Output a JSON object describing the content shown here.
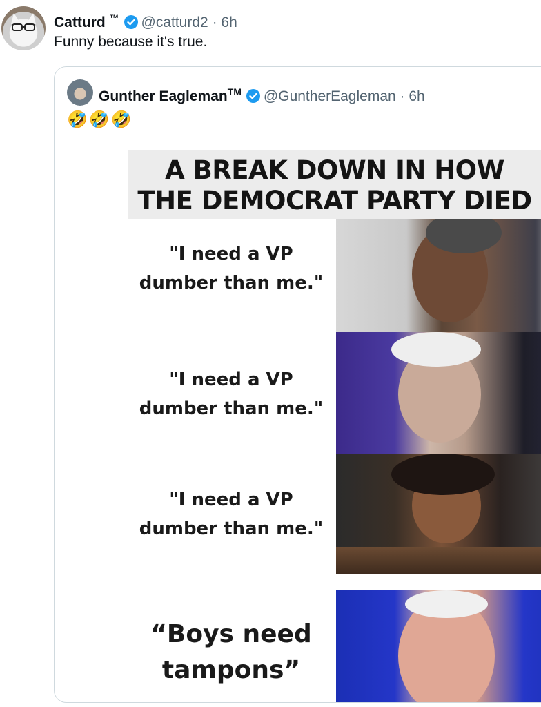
{
  "tweet": {
    "author_name": "Catturd",
    "author_tm": "™",
    "handle": "@catturd2",
    "separator": "·",
    "time": "6h",
    "text": "Funny because it's true."
  },
  "quoted_tweet": {
    "author_name": "Gunther Eagleman",
    "author_tm": "TM",
    "handle": "@GuntherEagleman",
    "separator": "·",
    "time": "6h",
    "text": "🤣🤣🤣",
    "meme": {
      "title_line1": "A BREAK DOWN IN HOW",
      "title_line2": "THE DEMOCRAT PARTY DIED",
      "panels": [
        {
          "line1": "\"I need a VP",
          "line2": "dumber than me.\""
        },
        {
          "line1": "\"I need a VP",
          "line2": "dumber than me.\""
        },
        {
          "line1": "\"I need a VP",
          "line2": "dumber than me.\""
        },
        {
          "line1": "“Boys need",
          "line2": "tampons”"
        }
      ]
    }
  },
  "colors": {
    "verified_badge": "#1d9bf0",
    "secondary_text": "#536471",
    "border": "#cfd9de"
  },
  "icons": [
    "verified-badge-icon"
  ]
}
